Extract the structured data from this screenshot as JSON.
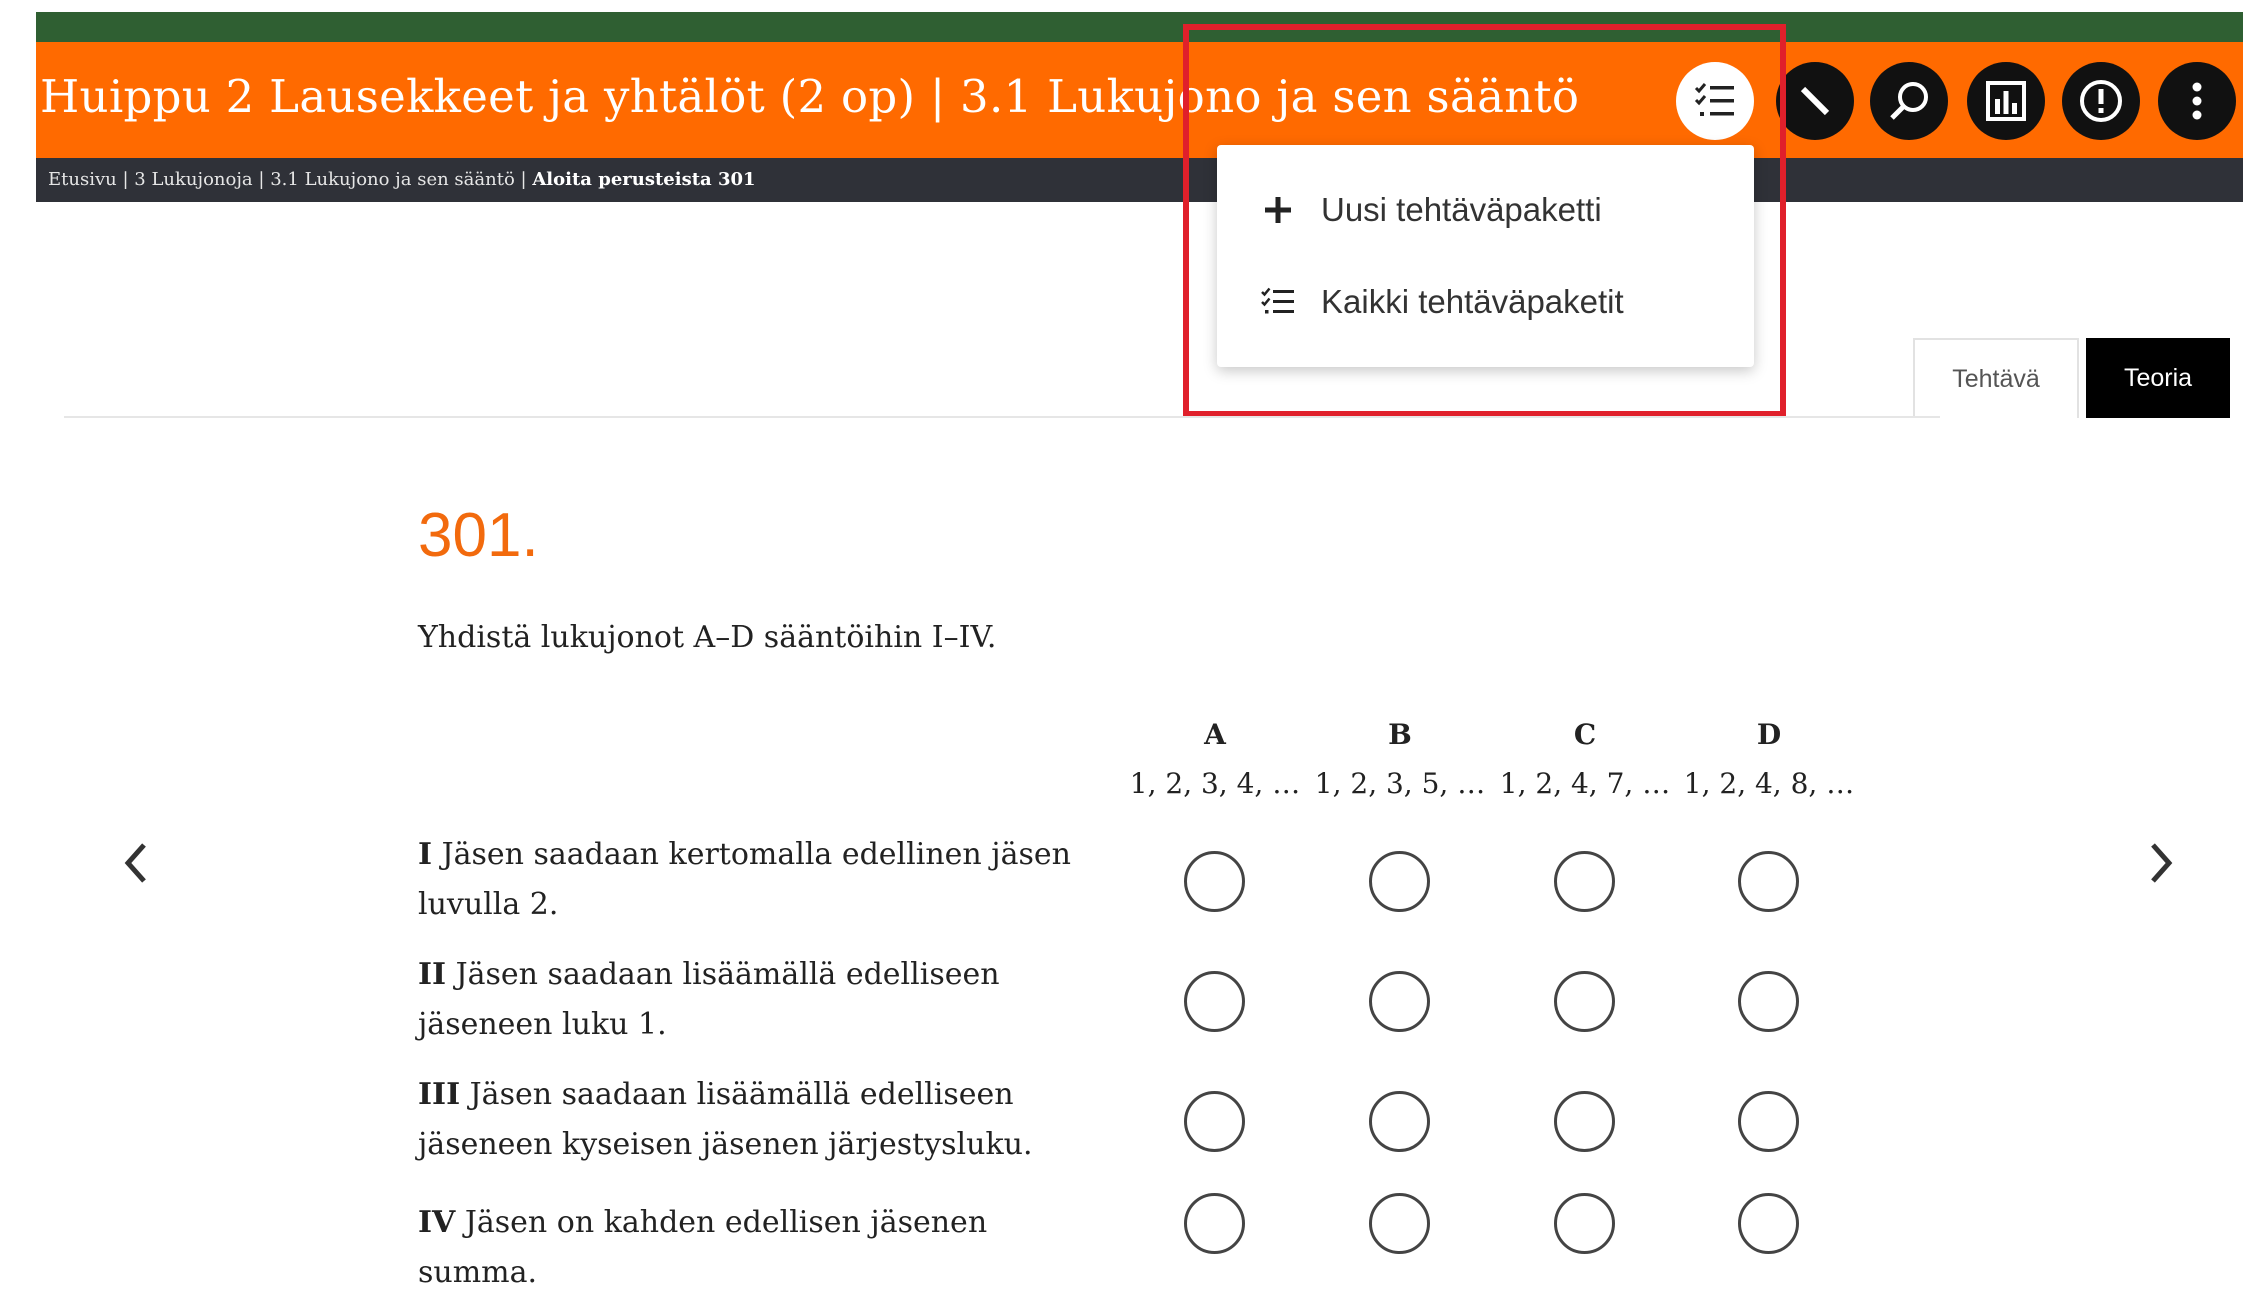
{
  "header": {
    "title": "Huippu 2 Lausekkeet ja yhtälöt (2 op)  |  3.1  Lukujono ja sen sääntö",
    "icons": [
      "tasks-list-icon",
      "pen-icon",
      "search-icon",
      "chart-icon",
      "alert-icon",
      "more-icon"
    ]
  },
  "breadcrumb": {
    "items": [
      "Etusivu",
      "3 Lukujonoja",
      "3.1 Lukujono ja sen sääntö"
    ],
    "current": "Aloita perusteista 301",
    "separator": "|"
  },
  "dropdown": {
    "items": [
      {
        "icon": "plus-icon",
        "label": "Uusi tehtäväpaketti"
      },
      {
        "icon": "list-icon",
        "label": "Kaikki tehtäväpaketit"
      }
    ]
  },
  "tabs": [
    {
      "label": "Tehtävä",
      "active": false
    },
    {
      "label": "Teoria",
      "active": true
    }
  ],
  "exercise": {
    "number": "301.",
    "instruction": "Yhdistä lukujonot A–D sääntöihin I–IV.",
    "columns": [
      {
        "label": "A",
        "sequence": "1, 2, 3, 4, …"
      },
      {
        "label": "B",
        "sequence": "1, 2, 3, 5, …"
      },
      {
        "label": "C",
        "sequence": "1, 2, 4, 7, …"
      },
      {
        "label": "D",
        "sequence": "1, 2, 4, 8, …"
      }
    ],
    "rules": [
      {
        "numeral": "I",
        "text": "Jäsen saadaan kertomalla edellinen jäsen luvulla 2."
      },
      {
        "numeral": "II",
        "text": "Jäsen saadaan lisäämällä edelliseen jäseneen luku 1."
      },
      {
        "numeral": "III",
        "text": "Jäsen saadaan lisäämällä edelliseen jäseneen kyseisen jäsenen järjestysluku."
      },
      {
        "numeral": "IV",
        "text": "Jäsen on kahden edellisen jäsenen summa."
      }
    ]
  },
  "colors": {
    "header_orange": "#ff6a00",
    "top_green": "#2f5f32",
    "breadcrumb_bg": "#2f3138",
    "exercise_number": "#f26a0d",
    "highlight_border": "#e0202b"
  }
}
